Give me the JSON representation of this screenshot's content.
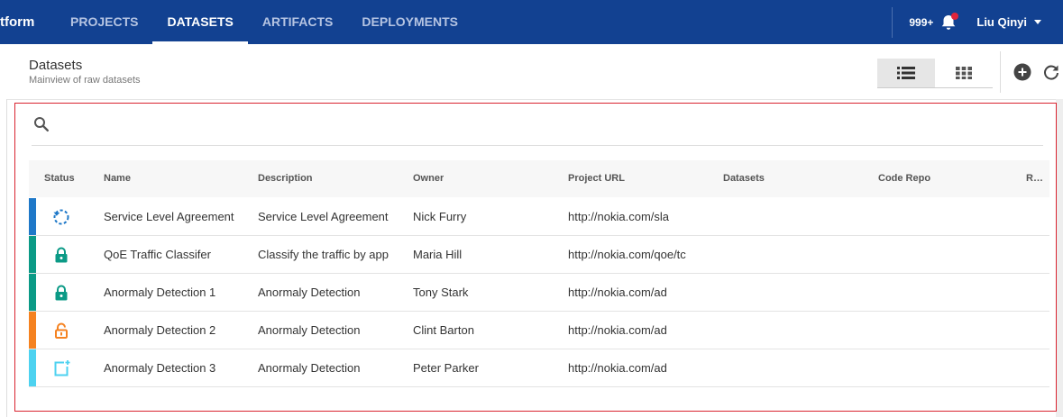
{
  "app": {
    "brand": "tform"
  },
  "nav": [
    {
      "label": "PROJECTS",
      "active": false
    },
    {
      "label": "DATASETS",
      "active": true
    },
    {
      "label": "ARTIFACTS",
      "active": false
    },
    {
      "label": "DEPLOYMENTS",
      "active": false
    }
  ],
  "topbar": {
    "notification_count": "999+",
    "user_name": "Liu Qinyi"
  },
  "header": {
    "title": "Datasets",
    "subtitle": "Mainview of raw datasets"
  },
  "icons": {
    "search": "search-icon",
    "bell": "bell-icon",
    "list_view": "list-view-icon",
    "grid_view": "grid-view-icon",
    "add": "add-circle-icon",
    "refresh": "refresh-icon"
  },
  "search": {
    "value": "",
    "placeholder": ""
  },
  "table": {
    "columns": [
      "Status",
      "Name",
      "Description",
      "Owner",
      "Project URL",
      "Datasets",
      "Code Repo",
      "R…"
    ],
    "rows": [
      {
        "status": "syncing",
        "stripe": "#1e78c8",
        "name": "Service Level Agreement",
        "description": "Service Level Agreement",
        "owner": "Nick Furry",
        "url": "http://nokia.com/sla",
        "datasets": "",
        "repo": ""
      },
      {
        "status": "locked",
        "stripe": "#0b9a86",
        "name": "QoE Traffic Classifer",
        "description": "Classify the traffic by app",
        "owner": "Maria Hill",
        "url": "http://nokia.com/qoe/tc",
        "datasets": "",
        "repo": ""
      },
      {
        "status": "locked",
        "stripe": "#0b9a86",
        "name": "Anormaly Detection 1",
        "description": "Anormaly Detection",
        "owner": "Tony Stark",
        "url": "http://nokia.com/ad",
        "datasets": "",
        "repo": ""
      },
      {
        "status": "unlocked",
        "stripe": "#f58220",
        "name": "Anormaly Detection 2",
        "description": "Anormaly Detection",
        "owner": "Clint Barton",
        "url": "http://nokia.com/ad",
        "datasets": "",
        "repo": ""
      },
      {
        "status": "new",
        "stripe": "#4dd2f0",
        "name": "Anormaly Detection 3",
        "description": "Anormaly Detection",
        "owner": "Peter Parker",
        "url": "http://nokia.com/ad",
        "datasets": "",
        "repo": ""
      }
    ]
  },
  "colors": {
    "topbar": "#124191",
    "highlight_border": "#d9232f",
    "syncing": "#1e78c8",
    "locked": "#0b9a86",
    "unlocked": "#f58220",
    "new": "#4dd2f0"
  }
}
